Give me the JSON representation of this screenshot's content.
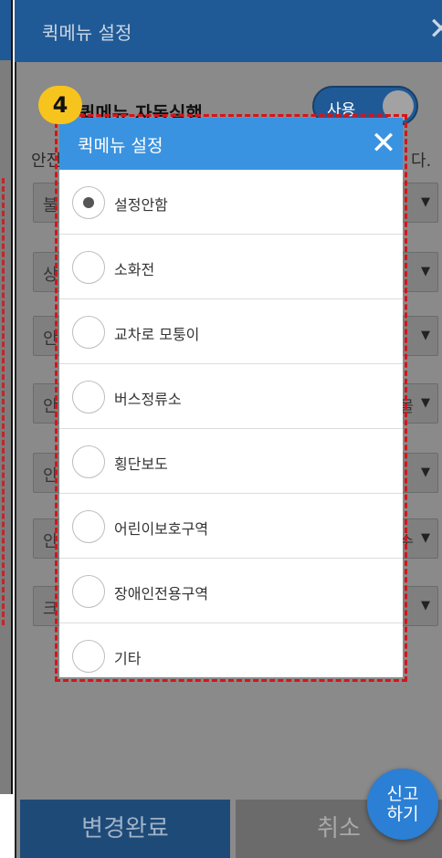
{
  "panel": {
    "title": "퀵메뉴 설정",
    "close_glyph": "✕",
    "auto_label": "퀵메뉴 자동실행",
    "toggle_label": "사용",
    "safety_label_start": "안전",
    "safety_label_end": "다.",
    "rows": [
      {
        "start": "불",
        "tail": ""
      },
      {
        "start": "상",
        "tail": ""
      },
      {
        "start": "안",
        "tail": ""
      },
      {
        "start": "안",
        "tail": "물"
      },
      {
        "start": "안",
        "tail": ""
      },
      {
        "start": "안",
        "tail": "수"
      },
      {
        "start": "크",
        "tail": ""
      }
    ],
    "select_caret": "▼"
  },
  "badge": "4",
  "dialog": {
    "title": "퀵메뉴 설정",
    "close_glyph": "✕",
    "options": [
      {
        "label": "설정안함",
        "selected": true
      },
      {
        "label": "소화전",
        "selected": false
      },
      {
        "label": "교차로 모퉁이",
        "selected": false
      },
      {
        "label": "버스정류소",
        "selected": false
      },
      {
        "label": "횡단보도",
        "selected": false
      },
      {
        "label": "어린이보호구역",
        "selected": false
      },
      {
        "label": "장애인전용구역",
        "selected": false
      },
      {
        "label": "기타",
        "selected": false
      }
    ]
  },
  "footer": {
    "done_label": "변경완료",
    "cancel_label": "취소",
    "report_line1": "신고",
    "report_line2": "하기"
  },
  "colors": {
    "header_blue": "#1f5a96",
    "dialog_blue": "#3a93e0",
    "highlight_red": "#d7141a",
    "badge_yellow": "#f7c41d",
    "report_blue": "#2b7fd4"
  }
}
